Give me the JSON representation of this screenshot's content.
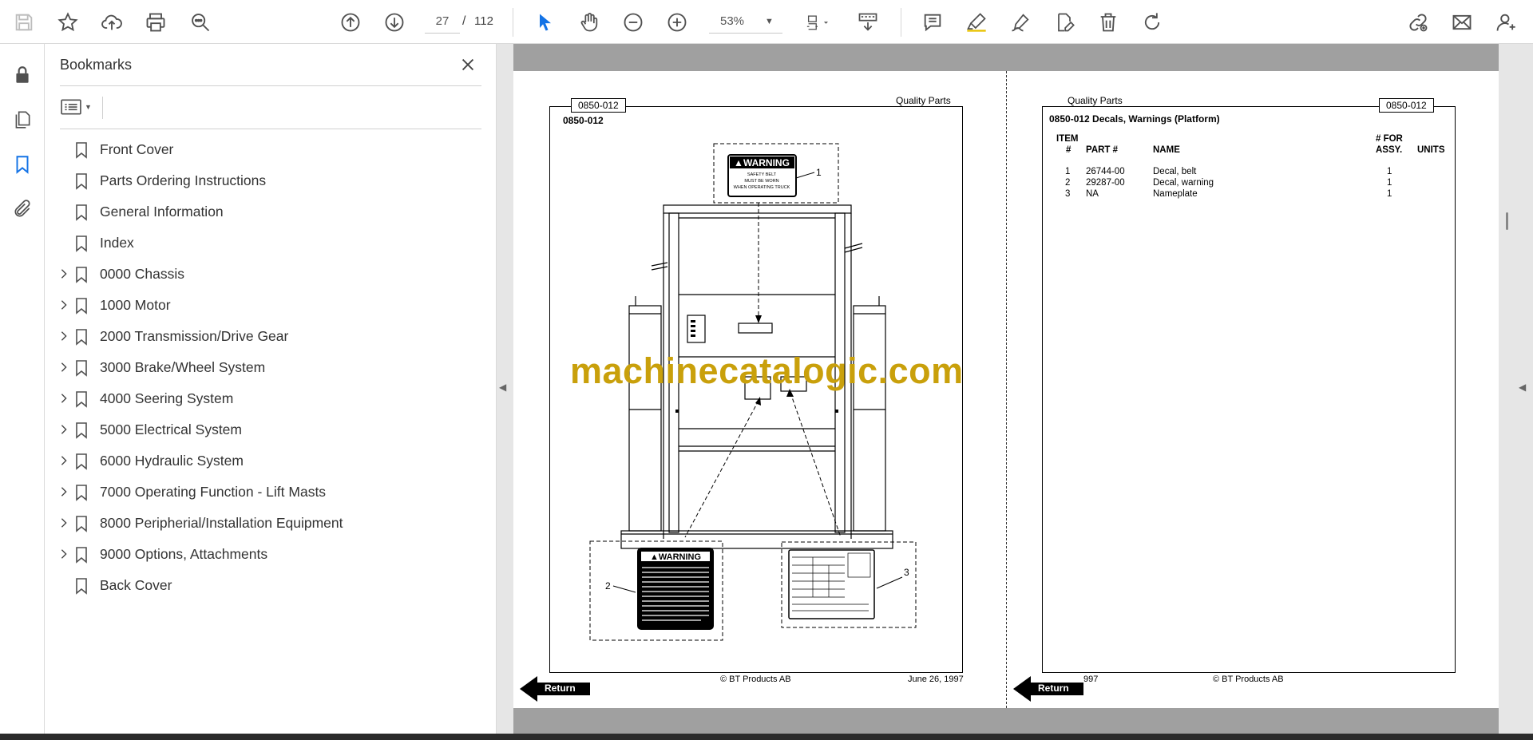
{
  "toolbar": {
    "current_page": "27",
    "page_separator": "/",
    "total_pages": "112",
    "zoom": "53%"
  },
  "bookmarks": {
    "title": "Bookmarks",
    "items": [
      {
        "label": "Front Cover",
        "expandable": false
      },
      {
        "label": "Parts Ordering Instructions",
        "expandable": false
      },
      {
        "label": "General Information",
        "expandable": false
      },
      {
        "label": "Index",
        "expandable": false
      },
      {
        "label": "0000 Chassis",
        "expandable": true
      },
      {
        "label": "1000 Motor",
        "expandable": true
      },
      {
        "label": "2000 Transmission/Drive Gear",
        "expandable": true
      },
      {
        "label": "3000 Brake/Wheel System",
        "expandable": true
      },
      {
        "label": "4000 Seering System",
        "expandable": true
      },
      {
        "label": "5000 Electrical System",
        "expandable": true
      },
      {
        "label": "6000 Hydraulic System",
        "expandable": true
      },
      {
        "label": "7000 Operating Function - Lift Masts",
        "expandable": true
      },
      {
        "label": "8000 Peripherial/Installation Equipment",
        "expandable": true
      },
      {
        "label": "9000 Options, Attachments",
        "expandable": true
      },
      {
        "label": "Back Cover",
        "expandable": false
      }
    ]
  },
  "document": {
    "left_page": {
      "tag": "0850-012",
      "header_right": "Quality Parts",
      "code": "0850-012",
      "warning_title": "WARNING",
      "warning_lines": [
        "SAFETY BELT",
        "MUST BE WORN",
        "WHEN OPERATING TRUCK"
      ],
      "callout_1": "1",
      "callout_2": "2",
      "callout_3": "3",
      "warning2_title": "WARNING",
      "footer_center": "© BT Products AB",
      "footer_right": "June 26, 1997",
      "return_label": "Return"
    },
    "right_page": {
      "header_left": "Quality Parts",
      "tag": "0850-012",
      "title": "0850-012 Decals, Warnings (Platform)",
      "columns": {
        "item_top": "ITEM",
        "item_bottom": "#",
        "part": "PART #",
        "name": "NAME",
        "for_top": "# FOR",
        "for_bottom": "ASSY.",
        "units": "UNITS"
      },
      "rows": [
        {
          "item": "1",
          "part": "26744-00",
          "name": "Decal, belt",
          "qty": "1"
        },
        {
          "item": "2",
          "part": "29287-00",
          "name": "Decal, warning",
          "qty": "1"
        },
        {
          "item": "3",
          "part": "NA",
          "name": "Nameplate",
          "qty": "1"
        }
      ],
      "footer_left": "997",
      "footer_center": "© BT Products AB",
      "return_label": "Return"
    },
    "watermark": "machinecatalogic.com"
  },
  "colors": {
    "accent": "#1473e6",
    "watermark": "#c9a00b",
    "icon": "#505050"
  }
}
